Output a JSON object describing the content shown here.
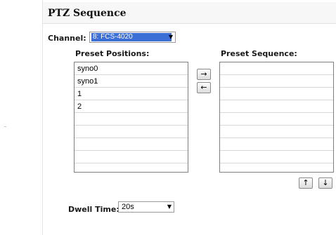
{
  "page": {
    "title": "PTZ Sequence"
  },
  "channel": {
    "label": "Channel:",
    "selected": "8: FCS-4020"
  },
  "preset_positions": {
    "label": "Preset Positions:",
    "items": [
      "syno0",
      "syno1",
      "1",
      "2",
      "",
      "",
      "",
      ""
    ]
  },
  "preset_sequence": {
    "label": "Preset Sequence:",
    "items": [
      "",
      "",
      "",
      "",
      "",
      "",
      "",
      ""
    ]
  },
  "buttons": {
    "add": "→",
    "remove": "←",
    "move_up": "↑",
    "move_down": "↓"
  },
  "dwell_time": {
    "label": "Dwell Time:",
    "selected": "20s"
  },
  "icons": {
    "dropdown": "▼"
  }
}
